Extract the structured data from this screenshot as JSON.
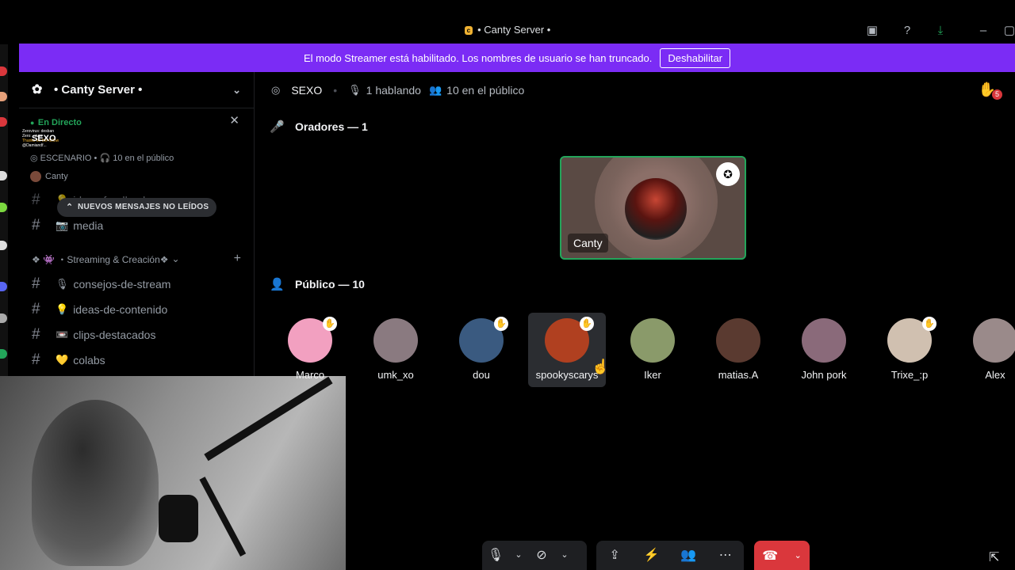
{
  "window": {
    "logo_text": "c",
    "title": "• Canty Server •"
  },
  "banner": {
    "message": "El modo Streamer está habilitado. Los nombres de usuario se han truncado.",
    "button": "Deshabilitar"
  },
  "sidebar": {
    "server_name": "• Canty Server •",
    "live": {
      "label": "En Directo",
      "stage_name": "SEXO",
      "stage_label": "ESCENARIO",
      "audience": "10 en el público",
      "host": "Canty"
    },
    "chat_overlay": [
      "Zerovirus: desban",
      "Zero: ...ivor",
      "Thanks for the follow",
      "@Damiandf..."
    ],
    "new_messages": "NUEVOS MENSAJES NO LEÍDOS",
    "channels_top": [
      {
        "emoji": "💡",
        "name": "ideas-feedback"
      },
      {
        "emoji": "📷",
        "name": "media"
      }
    ],
    "category": "❖ 👾 ・Streaming & Creación❖",
    "channels": [
      {
        "emoji": "🎙",
        "name": "consejos-de-stream"
      },
      {
        "emoji": "💡",
        "name": "ideas-de-contenido"
      },
      {
        "emoji": "📼",
        "name": "clips-destacados"
      },
      {
        "emoji": "💛",
        "name": "colabs"
      }
    ]
  },
  "stage": {
    "name": "SEXO",
    "speaking": "1 hablando",
    "audience": "10 en el público",
    "hand_count": "5",
    "speakers_header": "Oradores — 1",
    "speaker": {
      "name": "Canty"
    },
    "audience_header": "Público — 10",
    "audience_list": [
      {
        "name": "Marco",
        "hand": true,
        "color": "#f2a0c0"
      },
      {
        "name": "umk_xo",
        "hand": false,
        "color": "#8a7a80"
      },
      {
        "name": "dou",
        "hand": true,
        "color": "#3a5a80"
      },
      {
        "name": "spookyscarys",
        "hand": true,
        "color": "#b04020"
      },
      {
        "name": "Iker",
        "hand": false,
        "color": "#8a9a6a"
      },
      {
        "name": "matias.A",
        "hand": false,
        "color": "#5a3a30"
      },
      {
        "name": "John pork",
        "hand": false,
        "color": "#8a6a7a"
      },
      {
        "name": "Trixe_:p",
        "hand": true,
        "color": "#d0c0b0"
      },
      {
        "name": "Alex",
        "hand": false,
        "color": "#9a8a8a"
      }
    ]
  },
  "icons": {
    "server": "gear-icon",
    "stage": "broadcast-icon",
    "mic": "microphone-icon",
    "people": "people-icon",
    "hand": "raise-hand-icon",
    "camera": "camera-off-icon",
    "share": "screen-share-icon",
    "leave": "phone-hangup-icon"
  }
}
